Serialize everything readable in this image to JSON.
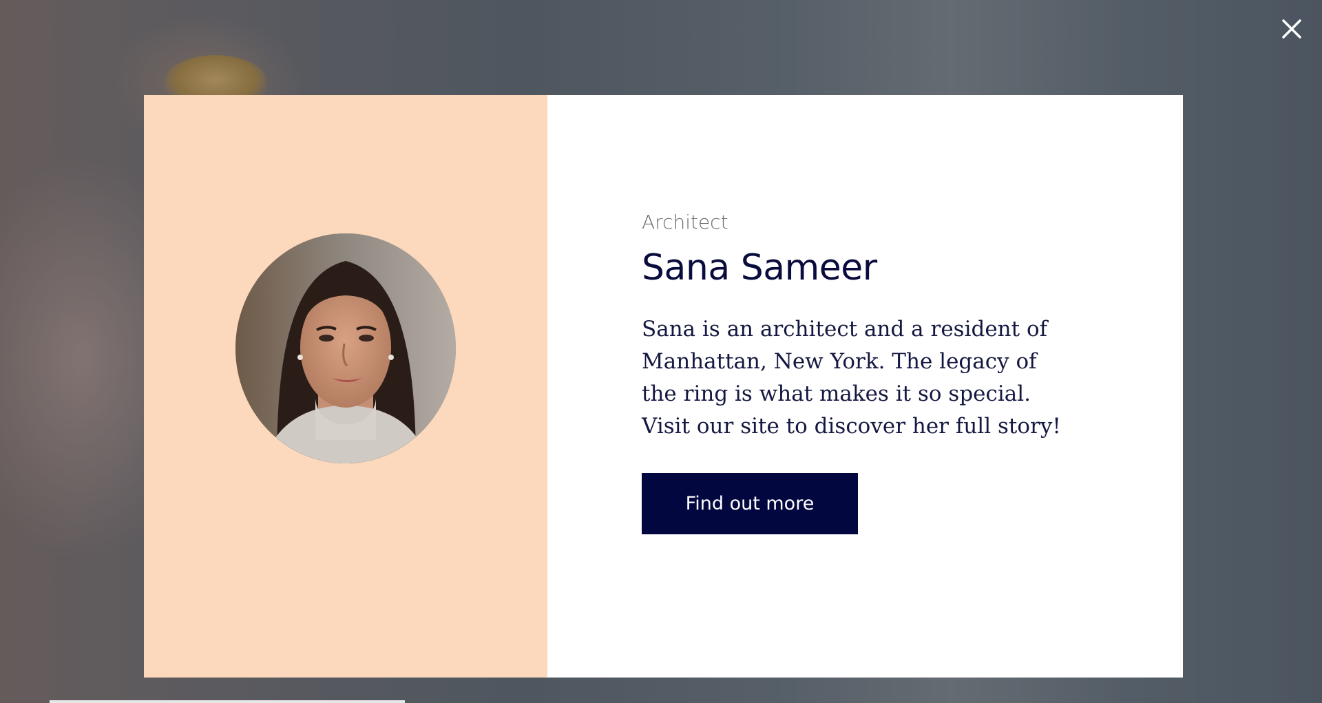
{
  "close_button": {
    "icon": "close-icon",
    "color": "#ffffff"
  },
  "modal": {
    "left_panel": {
      "background": "#fcd9bc"
    },
    "avatar": {
      "icon": "portrait-photo",
      "alt": ""
    },
    "role": "Architect",
    "name": "Sana Sameer",
    "bio": "Sana is an architect and a resident of Manhattan, New York. The legacy of the ring is what makes it so special. Visit our site to discover her full story!",
    "cta_label": "Find out more",
    "cta_color": "#03073f"
  }
}
